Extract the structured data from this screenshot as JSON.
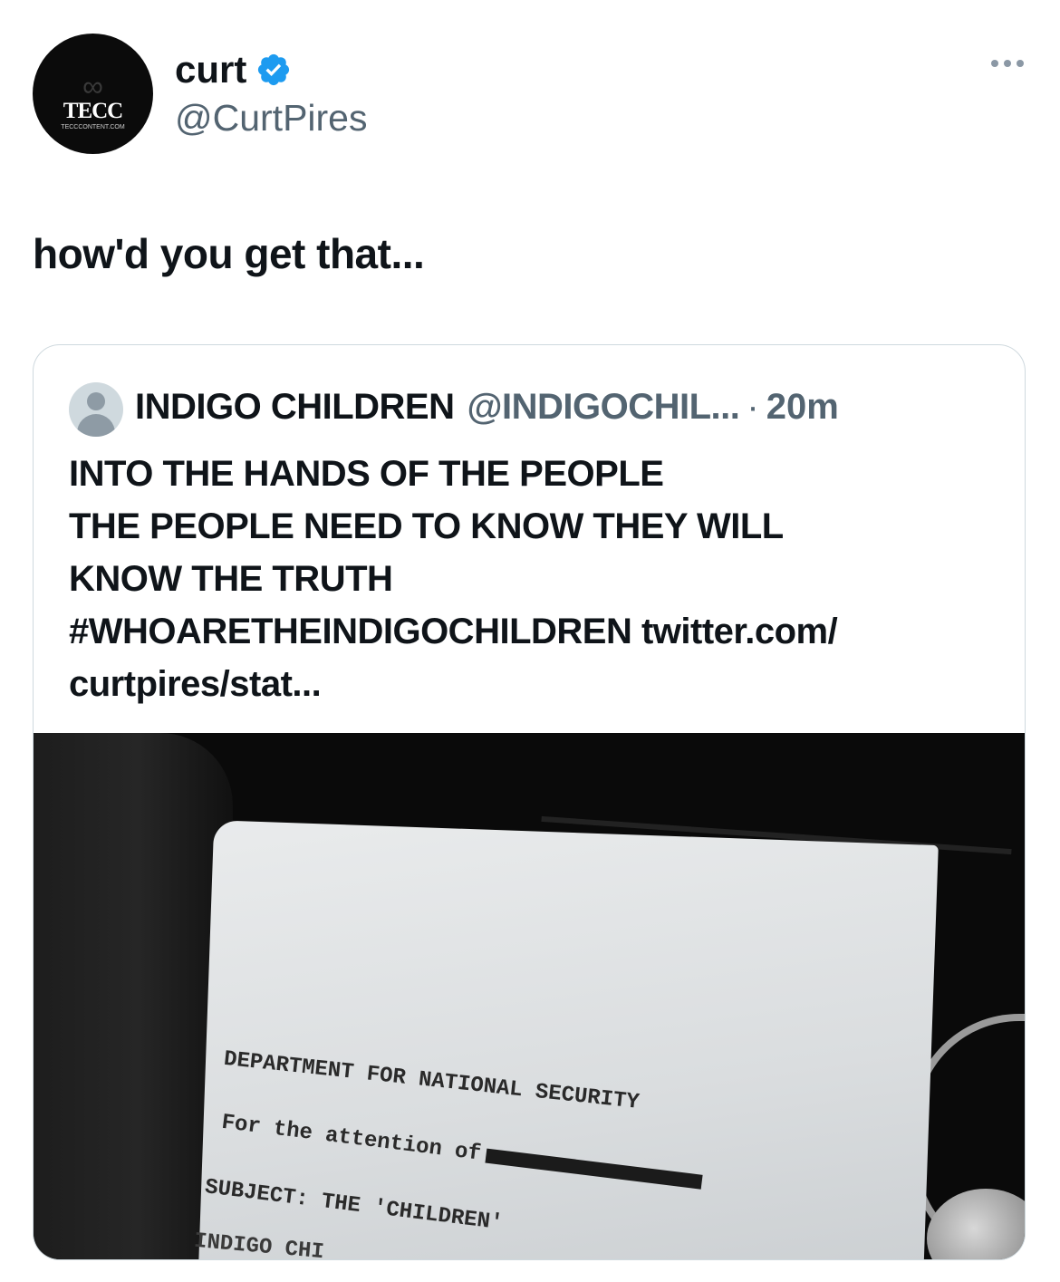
{
  "author": {
    "avatar_text": "TECC",
    "avatar_subtext": "TECCCONTENT.COM",
    "display_name": "curt",
    "handle": "@CurtPires",
    "verified_color": "#1d9bf0"
  },
  "tweet": {
    "text": "how'd you get that..."
  },
  "quoted": {
    "display_name": "INDIGO CHILDREN",
    "handle": "@INDIGOCHIL...",
    "separator": "·",
    "time": "20m",
    "lines": [
      "INTO THE HANDS OF THE PEOPLE",
      "THE PEOPLE NEED TO KNOW THEY WILL",
      "KNOW THE TRUTH",
      "#WHOARETHEINDIGOCHILDREN twitter.com/",
      "curtpires/stat..."
    ],
    "media": {
      "document_lines": {
        "heading": "DEPARTMENT FOR NATIONAL SECURITY",
        "attention": "For the attention of",
        "subject": "SUBJECT: THE 'CHILDREN'",
        "partial": "INDIGO CHI"
      }
    }
  }
}
